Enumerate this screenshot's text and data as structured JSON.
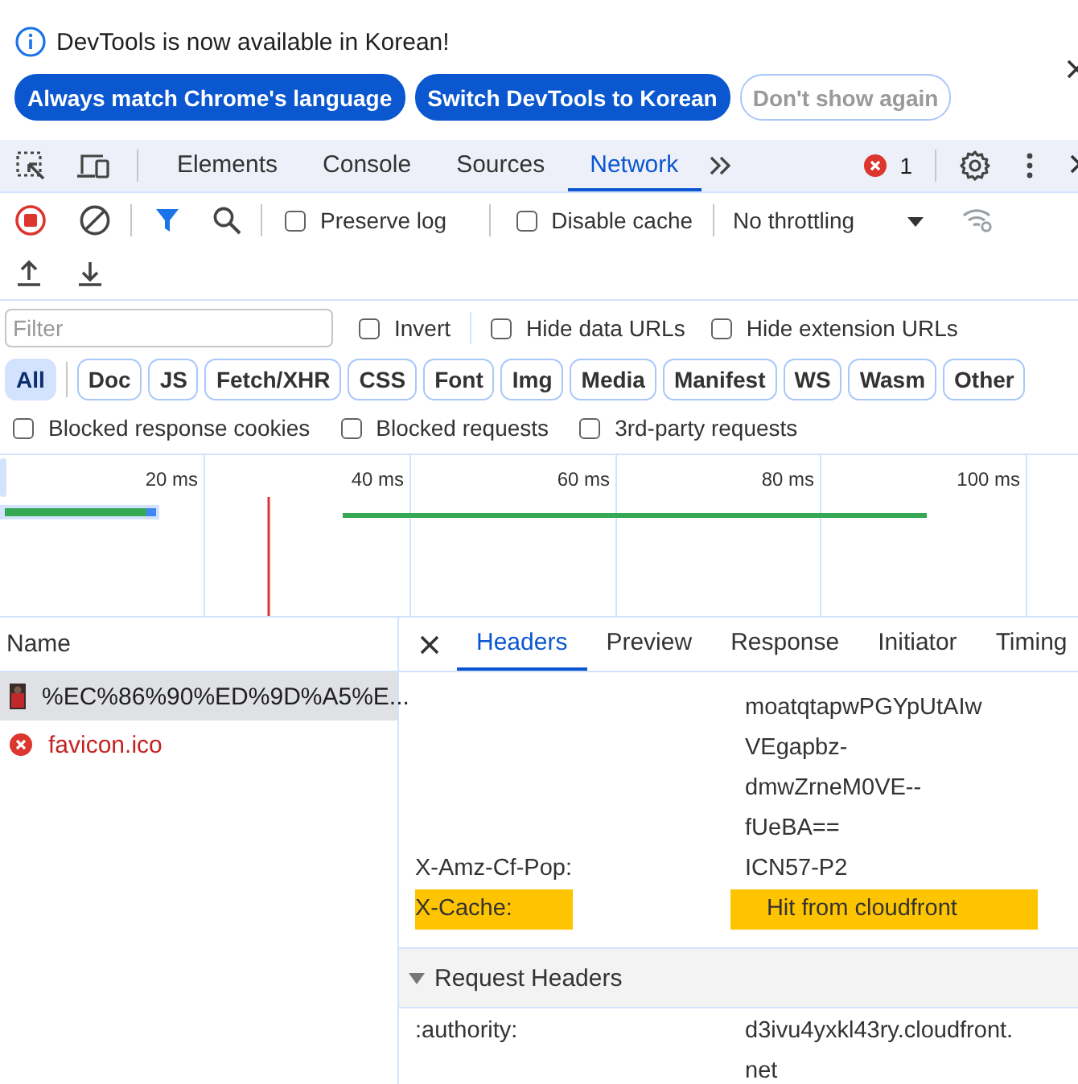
{
  "infobar": {
    "message": "DevTools is now available in Korean!",
    "buttons": [
      {
        "label": "Always match Chrome's language",
        "kind": "primary"
      },
      {
        "label": "Switch DevTools to Korean",
        "kind": "primary"
      },
      {
        "label": "Don't show again",
        "kind": "secondary"
      }
    ]
  },
  "main_tabs": [
    {
      "label": "Elements",
      "selected": false
    },
    {
      "label": "Console",
      "selected": false
    },
    {
      "label": "Sources",
      "selected": false
    },
    {
      "label": "Network",
      "selected": true
    }
  ],
  "error_count": "1",
  "toolbar": {
    "recording": true,
    "checkboxes": [
      {
        "label": "Preserve log",
        "checked": false
      },
      {
        "label": "Disable cache",
        "checked": false
      }
    ],
    "throttling": "No throttling"
  },
  "filter": {
    "placeholder": "Filter",
    "options": [
      {
        "label": "Invert",
        "checked": false
      },
      {
        "label": "Hide data URLs",
        "checked": false
      },
      {
        "label": "Hide extension URLs",
        "checked": false
      }
    ]
  },
  "type_filters": [
    {
      "label": "All",
      "selected": true
    },
    {
      "label": "Doc",
      "selected": false
    },
    {
      "label": "JS",
      "selected": false
    },
    {
      "label": "Fetch/XHR",
      "selected": false
    },
    {
      "label": "CSS",
      "selected": false
    },
    {
      "label": "Font",
      "selected": false
    },
    {
      "label": "Img",
      "selected": false
    },
    {
      "label": "Media",
      "selected": false
    },
    {
      "label": "Manifest",
      "selected": false
    },
    {
      "label": "WS",
      "selected": false
    },
    {
      "label": "Wasm",
      "selected": false
    },
    {
      "label": "Other",
      "selected": false
    }
  ],
  "extra_filters": [
    {
      "label": "Blocked response cookies",
      "checked": false
    },
    {
      "label": "Blocked requests",
      "checked": false
    },
    {
      "label": "3rd-party requests",
      "checked": false
    }
  ],
  "overview": {
    "ticks": [
      "20 ms",
      "40 ms",
      "60 ms",
      "80 ms",
      "100 ms"
    ]
  },
  "requests": {
    "column": "Name",
    "rows": [
      {
        "name": "%EC%86%90%ED%9D%A5%E...",
        "selected": true,
        "failed": false
      },
      {
        "name": "favicon.ico",
        "selected": false,
        "failed": true
      }
    ]
  },
  "detail_tabs": [
    {
      "label": "Headers",
      "selected": true
    },
    {
      "label": "Preview",
      "selected": false
    },
    {
      "label": "Response",
      "selected": false
    },
    {
      "label": "Initiator",
      "selected": false
    },
    {
      "label": "Timing",
      "selected": false
    }
  ],
  "headers": [
    {
      "value_lines": [
        "moatqtapwPGYpUtAIw",
        "VEgapbz-",
        "dmwZrneM0VE--",
        "fUeBA=="
      ],
      "highlighted": false
    },
    {
      "name": "X-Amz-Cf-Pop:",
      "value_lines": [
        "ICN57-P2"
      ],
      "highlighted": false
    },
    {
      "name": "X-Cache:",
      "value_lines": [
        "Hit from cloudfront"
      ],
      "highlighted": true
    }
  ],
  "request_headers": {
    "title": "Request Headers",
    "expanded": true,
    "rows": [
      {
        "name": ":authority:",
        "value_lines": [
          "d3ivu4yxkl43ry.cloudfront.",
          "net"
        ],
        "highlighted": false
      }
    ]
  }
}
